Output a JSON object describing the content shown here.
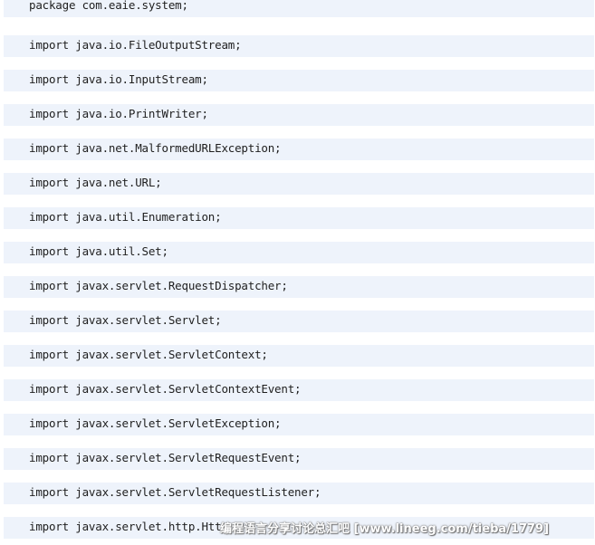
{
  "code": {
    "lines": [
      "package com.eaie.system;",
      "import java.io.FileOutputStream;",
      "import java.io.InputStream;",
      "import java.io.PrintWriter;",
      "import java.net.MalformedURLException;",
      "import java.net.URL;",
      "import java.util.Enumeration;",
      "import java.util.Set;",
      "import javax.servlet.RequestDispatcher;",
      "import javax.servlet.Servlet;",
      "import javax.servlet.ServletContext;",
      "import javax.servlet.ServletContextEvent;",
      "import javax.servlet.ServletException;",
      "import javax.servlet.ServletRequestEvent;",
      "import javax.servlet.ServletRequestListener;",
      "import javax.servlet.http.Http"
    ]
  },
  "watermark": {
    "text": "编程语言分享讨论总汇吧 [www.lineeg.com/tieba/1779]"
  }
}
